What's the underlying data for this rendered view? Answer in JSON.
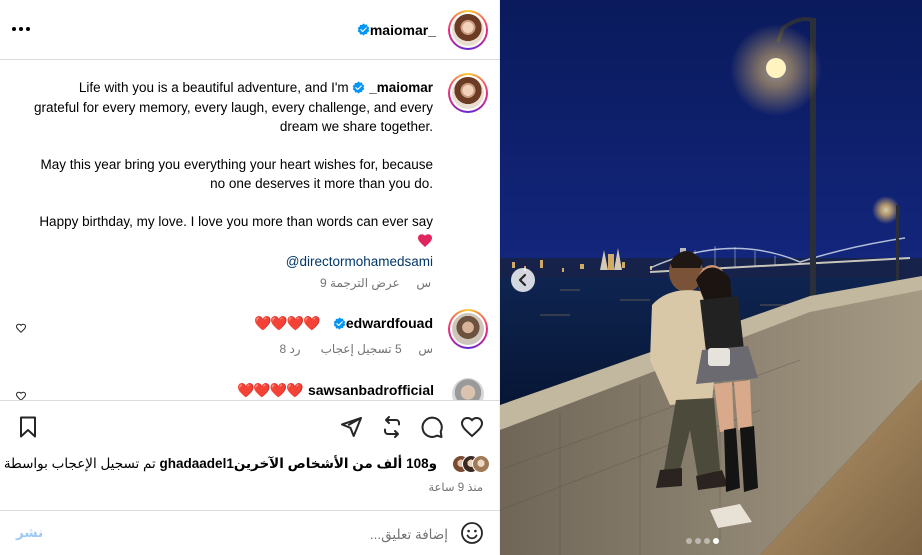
{
  "post": {
    "author": "maiomar_",
    "more_icon": "more-horizontal-icon",
    "verified_icon": "verified-badge-icon",
    "caption": {
      "line1_pre": "Life with you is a beautiful adventure, and I'm",
      "mention_author": "_maiomar",
      "line1_post": "grateful for every memory, every laugh, every challenge, and every dream we share together.",
      "paragraph2": "May this year bring you everything your heart wishes for, because no one deserves it more than you do.",
      "paragraph3": "Happy birthday, my love. I love you more than words can ever say",
      "tag": "@directormohamedsami"
    },
    "caption_time": "9 س",
    "see_translation": "عرض الترجمة"
  },
  "comments": [
    {
      "username": "edwardfouad",
      "text": "❤️❤️❤️❤️",
      "time": "8 س",
      "likes": "5 تسجيل إعجاب",
      "reply": "رد"
    },
    {
      "username": "sawsanbadrofficial",
      "text": "❤️❤️❤️❤️",
      "time": "",
      "likes": "",
      "reply": ""
    }
  ],
  "actions": {
    "like_icon": "heart-outline-icon",
    "comment_icon": "comment-bubble-icon",
    "repost_icon": "repost-icon",
    "share_icon": "send-icon",
    "save_icon": "bookmark-icon"
  },
  "likes_summary": {
    "prefix": "تم تسجيل الإعجاب بواسطة",
    "user": "ghadaadel1",
    "suffix": "و108 ألف من الأشخاص الآخرين"
  },
  "timestamp": "منذ 9 ساعة",
  "add_comment": {
    "placeholder": "إضافة تعليق...",
    "post_label": "نشر",
    "emoji_icon": "emoji-smile-icon"
  },
  "carousel": {
    "prev_icon": "chevron-left-icon",
    "slide_count": 4,
    "active_slide": 3
  },
  "colors": {
    "link": "#00376b",
    "muted": "#737373",
    "verified": "#0095f6",
    "heart": "#e0245e",
    "post_disabled": "#9fc9f5"
  }
}
